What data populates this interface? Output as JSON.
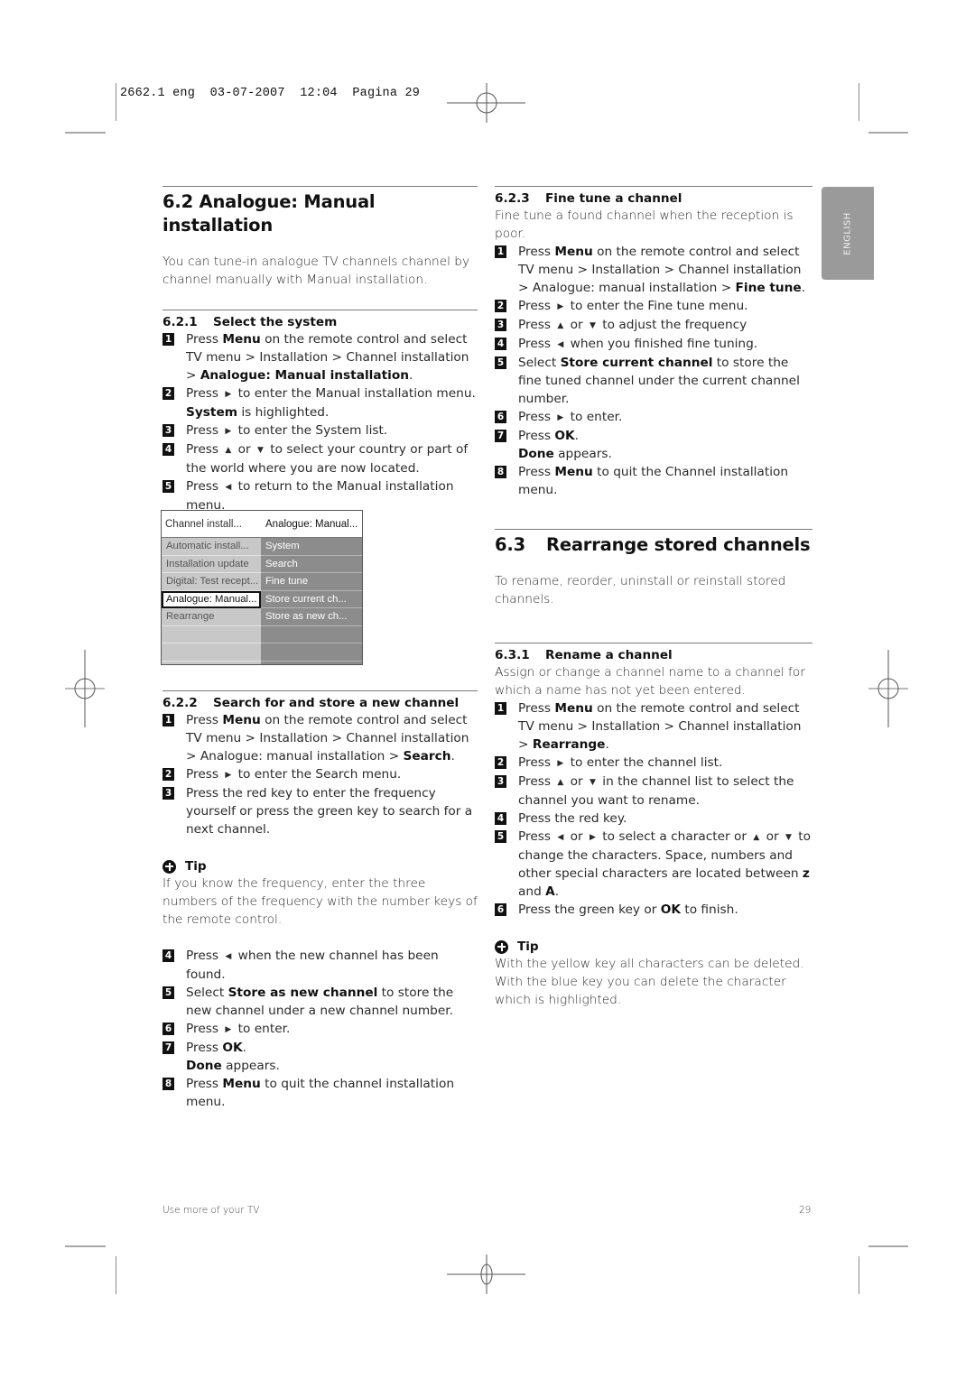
{
  "slug": "2662.1 eng  03-07-2007  12:04  Pagina 29",
  "language_tab": "ENGLISH",
  "section_62": {
    "number": "6.2",
    "title": "Analogue: Manual installation",
    "intro": "You can tune-in analogue TV channels channel by channel manually with Manual installation.",
    "sub_621": {
      "number": "6.2.1",
      "title": "Select the system",
      "steps": [
        {
          "n": "1",
          "parts": [
            "Press ",
            {
              "b": "Menu"
            },
            " on the remote control and select TV menu > Installation > Channel installation > ",
            {
              "b": "Analogue: Manual installation"
            },
            "."
          ]
        },
        {
          "n": "2",
          "parts": [
            "Press ",
            {
              "arrow": "right"
            },
            " to enter the Manual installation menu. ",
            {
              "b": "System"
            },
            " is highlighted."
          ]
        },
        {
          "n": "3",
          "parts": [
            "Press ",
            {
              "arrow": "right"
            },
            " to enter the System list."
          ]
        },
        {
          "n": "4",
          "parts": [
            "Press ",
            {
              "arrow": "up"
            },
            " or ",
            {
              "arrow": "down"
            },
            " to select your country or part of the world where you are now located."
          ]
        },
        {
          "n": "5",
          "parts": [
            "Press ",
            {
              "arrow": "left"
            },
            " to return to the Manual installation menu."
          ]
        }
      ]
    },
    "tv_menu": {
      "header_left": "Channel install...",
      "header_right": "Analogue: Manual...",
      "left_items": [
        "Automatic install...",
        "Installation update",
        "Digital: Test recept...",
        "Analogue: Manual...",
        "Rearrange",
        "",
        ""
      ],
      "selected_index": 3,
      "right_items": [
        "System",
        "Search",
        "Fine tune",
        "Store current ch...",
        "Store as new ch...",
        "",
        ""
      ]
    },
    "sub_622": {
      "number": "6.2.2",
      "title": "Search for and store a new channel",
      "steps_a": [
        {
          "n": "1",
          "parts": [
            "Press ",
            {
              "b": "Menu"
            },
            " on the remote control and select TV menu > Installation > Channel installation > Analogue: manual installation > ",
            {
              "b": "Search"
            },
            "."
          ]
        },
        {
          "n": "2",
          "parts": [
            "Press ",
            {
              "arrow": "right"
            },
            " to enter the Search menu."
          ]
        },
        {
          "n": "3",
          "parts": [
            "Press the red key to enter the frequency yourself or press the green key to search for a next channel."
          ]
        }
      ],
      "tip_label": "Tip",
      "tip_text": "If you know the frequency, enter the three numbers of the frequency with the number keys of the remote control.",
      "steps_b": [
        {
          "n": "4",
          "parts": [
            "Press ",
            {
              "arrow": "left"
            },
            " when the new channel has been found."
          ]
        },
        {
          "n": "5",
          "parts": [
            "Select ",
            {
              "b": "Store as new channel"
            },
            " to store the new channel under a new channel number."
          ]
        },
        {
          "n": "6",
          "parts": [
            "Press ",
            {
              "arrow": "right"
            },
            " to enter."
          ]
        },
        {
          "n": "7",
          "parts": [
            "Press ",
            {
              "b": "OK"
            },
            ".",
            {
              "br": true
            },
            {
              "b": "Done"
            },
            " appears."
          ]
        },
        {
          "n": "8",
          "parts": [
            "Press ",
            {
              "b": "Menu"
            },
            " to quit the channel installation menu."
          ]
        }
      ]
    },
    "sub_623": {
      "number": "6.2.3",
      "title": "Fine tune a channel",
      "intro": "Fine tune a found channel when the reception is poor.",
      "steps": [
        {
          "n": "1",
          "parts": [
            "Press ",
            {
              "b": "Menu"
            },
            " on the remote control and select TV menu > Installation > Channel installation > Analogue: manual installation > ",
            {
              "b": "Fine tune"
            },
            "."
          ]
        },
        {
          "n": "2",
          "parts": [
            "Press ",
            {
              "arrow": "right"
            },
            " to enter the Fine tune menu."
          ]
        },
        {
          "n": "3",
          "parts": [
            "Press ",
            {
              "arrow": "up"
            },
            " or ",
            {
              "arrow": "down"
            },
            " to adjust the frequency"
          ]
        },
        {
          "n": "4",
          "parts": [
            "Press ",
            {
              "arrow": "left"
            },
            " when you finished fine tuning."
          ]
        },
        {
          "n": "5",
          "parts": [
            "Select ",
            {
              "b": "Store current channel"
            },
            " to store the fine tuned channel under the current channel number."
          ]
        },
        {
          "n": "6",
          "parts": [
            "Press ",
            {
              "arrow": "right"
            },
            " to enter."
          ]
        },
        {
          "n": "7",
          "parts": [
            "Press ",
            {
              "b": "OK"
            },
            ".",
            {
              "br": true
            },
            {
              "b": "Done"
            },
            " appears."
          ]
        },
        {
          "n": "8",
          "parts": [
            "Press ",
            {
              "b": "Menu"
            },
            " to quit the Channel installation menu."
          ]
        }
      ]
    }
  },
  "section_63": {
    "number": "6.3",
    "title": "Rearrange stored channels",
    "intro": "To rename, reorder, uninstall or reinstall stored channels.",
    "sub_631": {
      "number": "6.3.1",
      "title": "Rename a channel",
      "intro": "Assign or change a channel name to a channel for which a name has not yet been entered.",
      "steps": [
        {
          "n": "1",
          "parts": [
            "Press ",
            {
              "b": "Menu"
            },
            " on the remote control and select TV menu > Installation > Channel installation > ",
            {
              "b": "Rearrange"
            },
            "."
          ]
        },
        {
          "n": "2",
          "parts": [
            "Press ",
            {
              "arrow": "right"
            },
            " to enter the channel list."
          ]
        },
        {
          "n": "3",
          "parts": [
            "Press ",
            {
              "arrow": "up"
            },
            " or ",
            {
              "arrow": "down"
            },
            " in the channel list to select the channel you want to rename."
          ]
        },
        {
          "n": "4",
          "parts": [
            "Press the red key."
          ]
        },
        {
          "n": "5",
          "parts": [
            "Press ",
            {
              "arrow": "left"
            },
            " or ",
            {
              "arrow": "right"
            },
            " to select a character or ",
            {
              "arrow": "up"
            },
            " or ",
            {
              "arrow": "down"
            },
            " to change the characters. Space, numbers and other special characters are located between ",
            {
              "b": "z"
            },
            " and ",
            {
              "b": "A"
            },
            "."
          ]
        },
        {
          "n": "6",
          "parts": [
            "Press the green key or ",
            {
              "b": "OK"
            },
            " to finish."
          ]
        }
      ],
      "tip_label": "Tip",
      "tip_text": "With the yellow key all characters can be deleted. With the blue key you can delete the character which is highlighted."
    }
  },
  "footer": {
    "left": "Use more of your TV",
    "page_number": "29"
  }
}
